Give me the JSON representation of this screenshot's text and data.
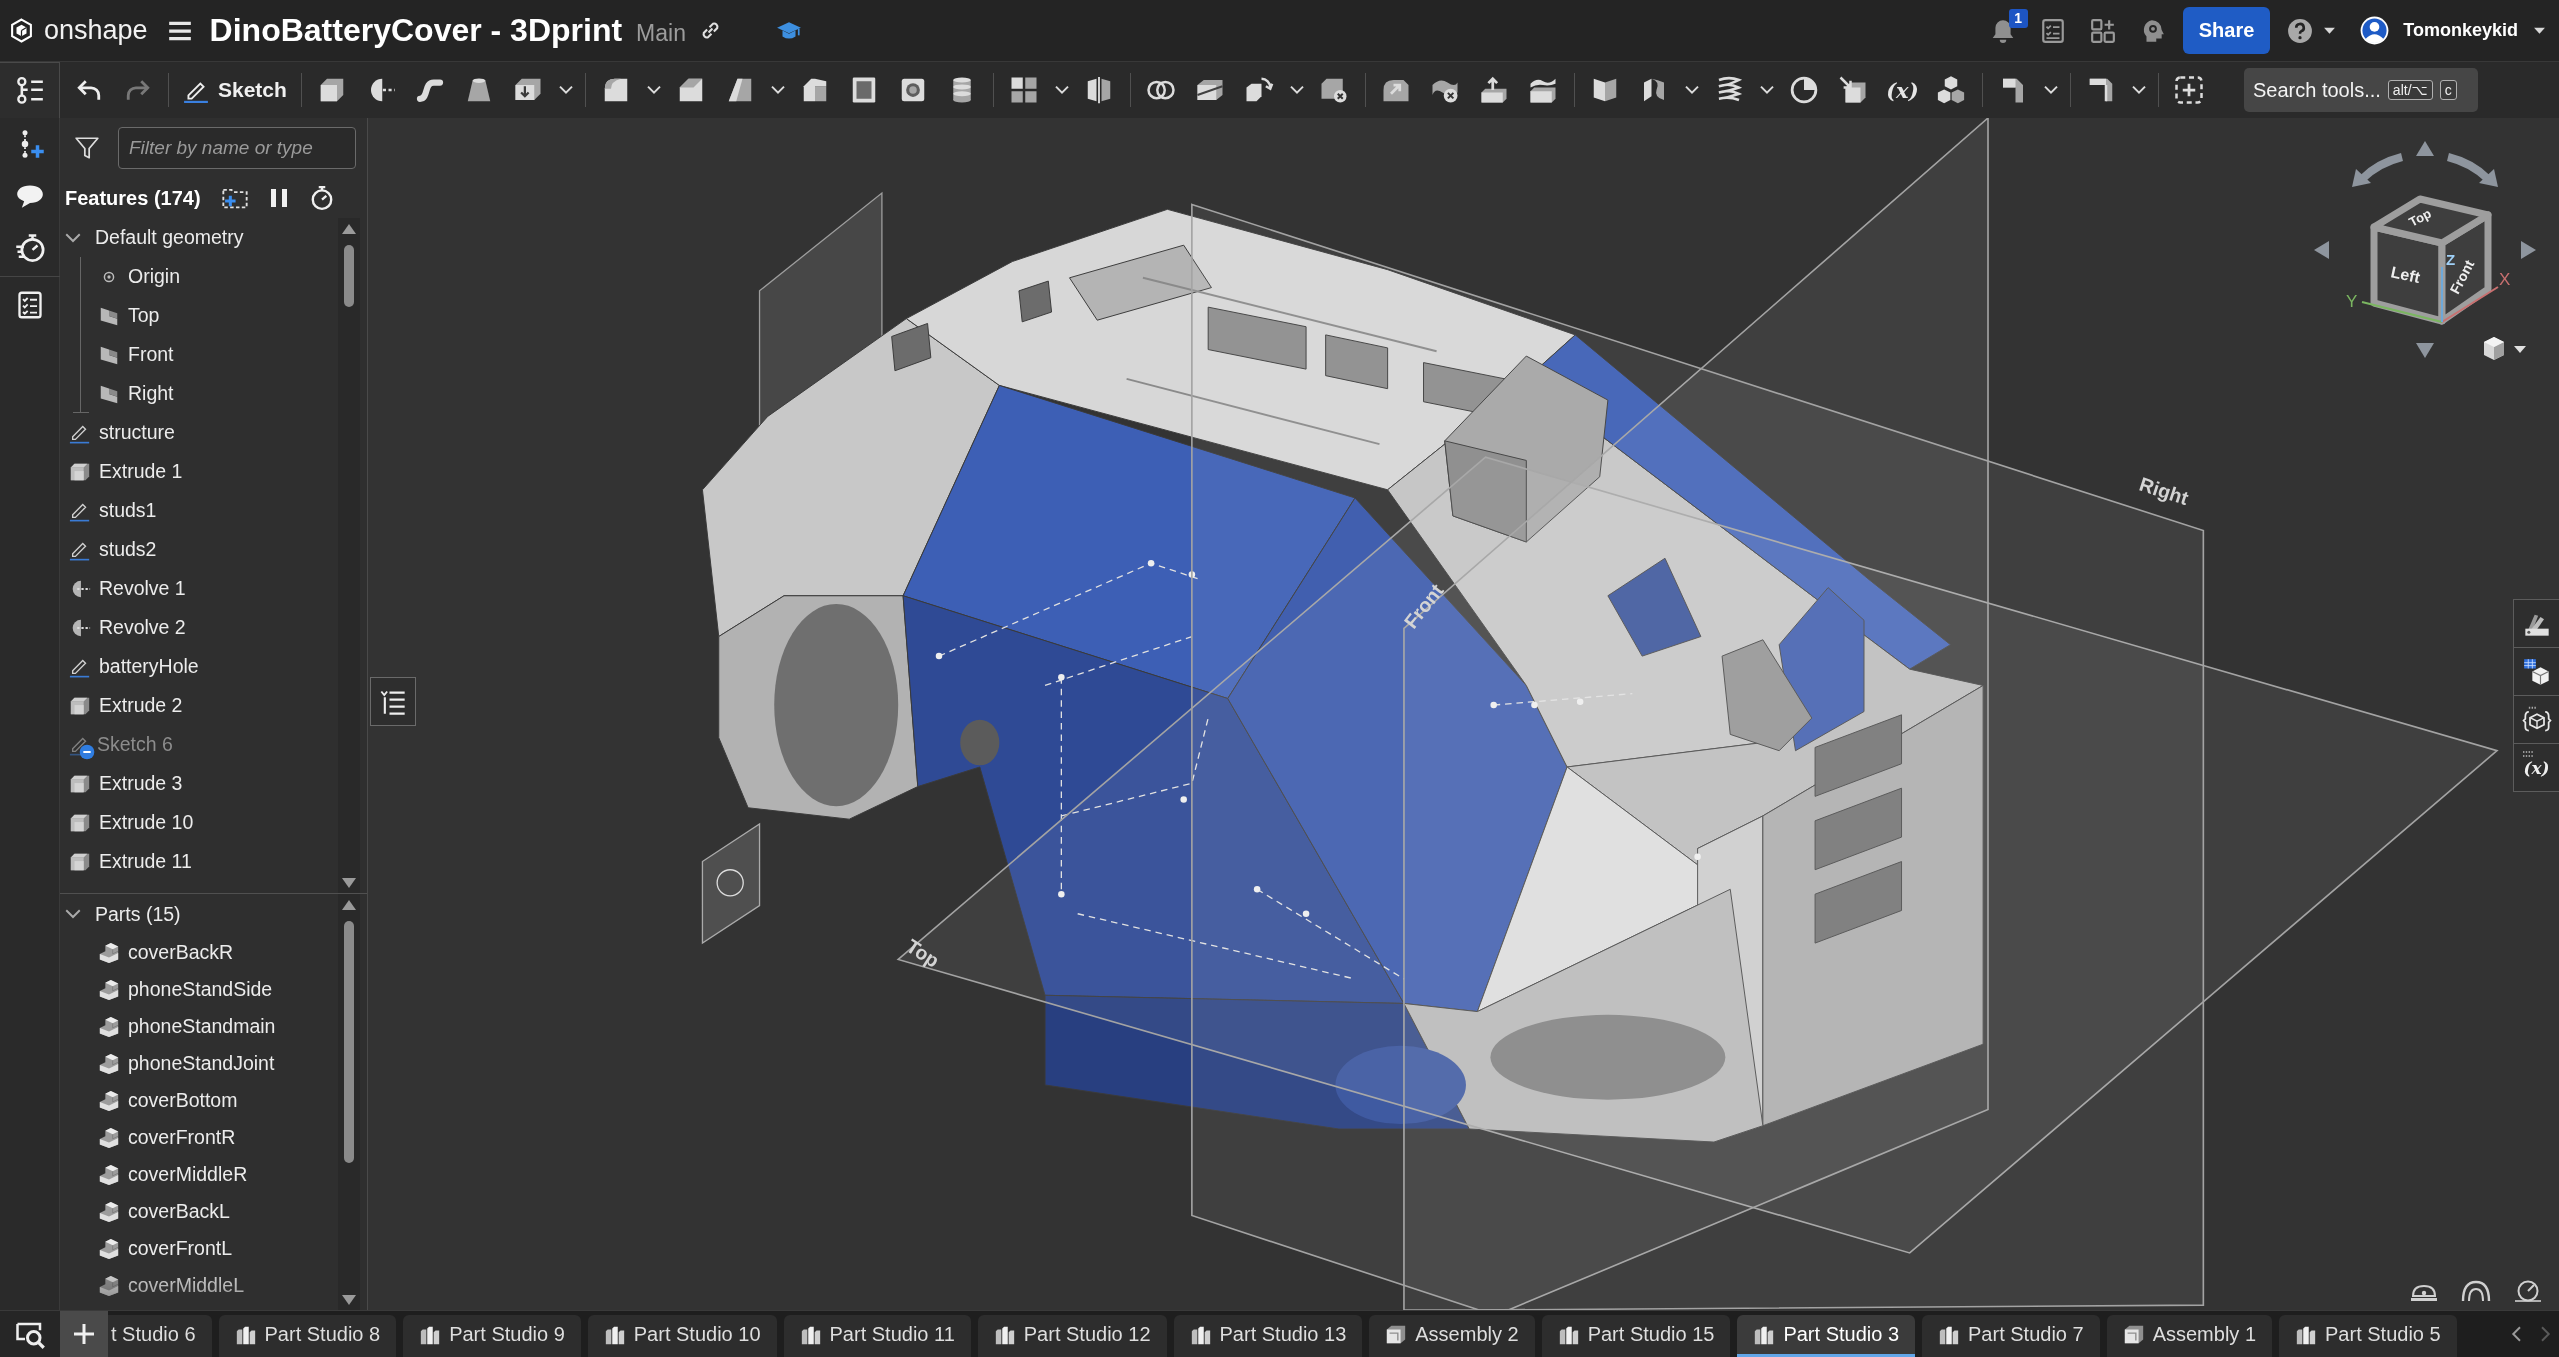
{
  "header": {
    "brand": "onshape",
    "title": "DinoBatteryCover - 3Dprint",
    "branch": "Main",
    "notifications": "1",
    "share": "Share",
    "user": "Tomonkeykid"
  },
  "toolbar": {
    "undo": {
      "disabled": false
    },
    "redo": {
      "disabled": true
    },
    "sketch": {
      "label": "Sketch"
    },
    "groups": [
      [
        {
          "kind": "extrude"
        },
        {
          "kind": "revolve"
        },
        {
          "kind": "sweep"
        },
        {
          "kind": "loft"
        },
        {
          "kind": "thicken"
        },
        {
          "kind": "caret"
        }
      ],
      [
        {
          "kind": "fillet"
        },
        {
          "kind": "caret"
        },
        {
          "kind": "chamfer"
        },
        {
          "kind": "draft"
        },
        {
          "kind": "caret"
        },
        {
          "kind": "rib"
        },
        {
          "kind": "shell"
        },
        {
          "kind": "hole"
        },
        {
          "kind": "stack"
        }
      ],
      [
        {
          "kind": "pattern"
        },
        {
          "kind": "caret"
        },
        {
          "kind": "mirror"
        }
      ],
      [
        {
          "kind": "boolean"
        },
        {
          "kind": "split"
        },
        {
          "kind": "transform"
        },
        {
          "kind": "caret"
        },
        {
          "kind": "delete-part"
        }
      ],
      [
        {
          "kind": "modify-fillet"
        },
        {
          "kind": "delete-face"
        },
        {
          "kind": "move-face"
        },
        {
          "kind": "replace-face"
        }
      ],
      [
        {
          "kind": "plane"
        },
        {
          "kind": "connector"
        },
        {
          "kind": "caret"
        },
        {
          "kind": "helix"
        },
        {
          "kind": "caret"
        },
        {
          "kind": "section"
        },
        {
          "kind": "derived"
        },
        {
          "kind": "variable",
          "label": "(x)"
        },
        {
          "kind": "configurations"
        }
      ],
      [
        {
          "kind": "sheet-metal"
        },
        {
          "kind": "caret"
        }
      ],
      [
        {
          "kind": "frame"
        },
        {
          "kind": "caret"
        }
      ],
      [
        {
          "kind": "custom"
        }
      ]
    ],
    "search": {
      "label": "Search tools...",
      "keys": [
        "alt/⌥",
        "c"
      ]
    }
  },
  "sidebar": {
    "filter": {
      "placeholder": "Filter by name or type"
    },
    "features": {
      "title": "Features (174)",
      "items": [
        {
          "label": "Default geometry",
          "kind": "group",
          "expanded": true,
          "suppressed": false,
          "children": [
            {
              "label": "Origin",
              "kind": "origin",
              "suppressed": false
            },
            {
              "label": "Top",
              "kind": "plane",
              "suppressed": false
            },
            {
              "label": "Front",
              "kind": "plane",
              "suppressed": false
            },
            {
              "label": "Right",
              "kind": "plane",
              "suppressed": false
            }
          ]
        },
        {
          "label": "structure",
          "kind": "sketch",
          "suppressed": false
        },
        {
          "label": "Extrude 1",
          "kind": "extrude",
          "suppressed": false
        },
        {
          "label": "studs1",
          "kind": "sketch",
          "suppressed": false
        },
        {
          "label": "studs2",
          "kind": "sketch",
          "suppressed": false
        },
        {
          "label": "Revolve 1",
          "kind": "revolve",
          "suppressed": false
        },
        {
          "label": "Revolve 2",
          "kind": "revolve",
          "suppressed": false
        },
        {
          "label": "batteryHole",
          "kind": "sketch",
          "suppressed": false
        },
        {
          "label": "Extrude 2",
          "kind": "extrude",
          "suppressed": false
        },
        {
          "label": "Sketch 6",
          "kind": "sketch",
          "suppressed": true
        },
        {
          "label": "Extrude 3",
          "kind": "extrude",
          "suppressed": false
        },
        {
          "label": "Extrude 10",
          "kind": "extrude",
          "suppressed": false
        },
        {
          "label": "Extrude 11",
          "kind": "extrude",
          "suppressed": false
        }
      ]
    },
    "parts": {
      "title": "Parts (15)",
      "expanded": true,
      "items": [
        "coverBackR",
        "phoneStandSide",
        "phoneStandmain",
        "phoneStandJoint",
        "coverBottom",
        "coverFrontR",
        "coverMiddleR",
        "coverBackL",
        "coverFrontL",
        "coverMiddleL"
      ]
    }
  },
  "viewport": {
    "planes": [
      {
        "kind": "top",
        "label": "Top"
      },
      {
        "kind": "front",
        "label": "Front"
      },
      {
        "kind": "right",
        "label": "Right"
      }
    ],
    "view_cube": {
      "top": "Top",
      "left": "Left",
      "front": "Front",
      "x": "X",
      "y": "Y",
      "z": "Z"
    },
    "side_tools": [
      {
        "kind": "appearance"
      },
      {
        "kind": "parts-table"
      },
      {
        "kind": "config"
      },
      {
        "kind": "variables",
        "label": "(x)"
      }
    ]
  },
  "tabs": [
    {
      "label": "t Studio 6",
      "kind": "clipped",
      "selected": false
    },
    {
      "label": "Part Studio 8",
      "kind": "part-studio",
      "selected": false
    },
    {
      "label": "Part Studio 9",
      "kind": "part-studio",
      "selected": false
    },
    {
      "label": "Part Studio 10",
      "kind": "part-studio",
      "selected": false
    },
    {
      "label": "Part Studio 11",
      "kind": "part-studio",
      "selected": false
    },
    {
      "label": "Part Studio 12",
      "kind": "part-studio",
      "selected": false
    },
    {
      "label": "Part Studio 13",
      "kind": "part-studio",
      "selected": false
    },
    {
      "label": "Assembly 2",
      "kind": "assembly",
      "selected": false
    },
    {
      "label": "Part Studio 15",
      "kind": "part-studio",
      "selected": false
    },
    {
      "label": "Part Studio 3",
      "kind": "part-studio",
      "selected": true
    },
    {
      "label": "Part Studio 7",
      "kind": "part-studio",
      "selected": false
    },
    {
      "label": "Assembly 1",
      "kind": "assembly",
      "selected": false
    },
    {
      "label": "Part Studio 5",
      "kind": "part-studio",
      "selected": false
    }
  ]
}
